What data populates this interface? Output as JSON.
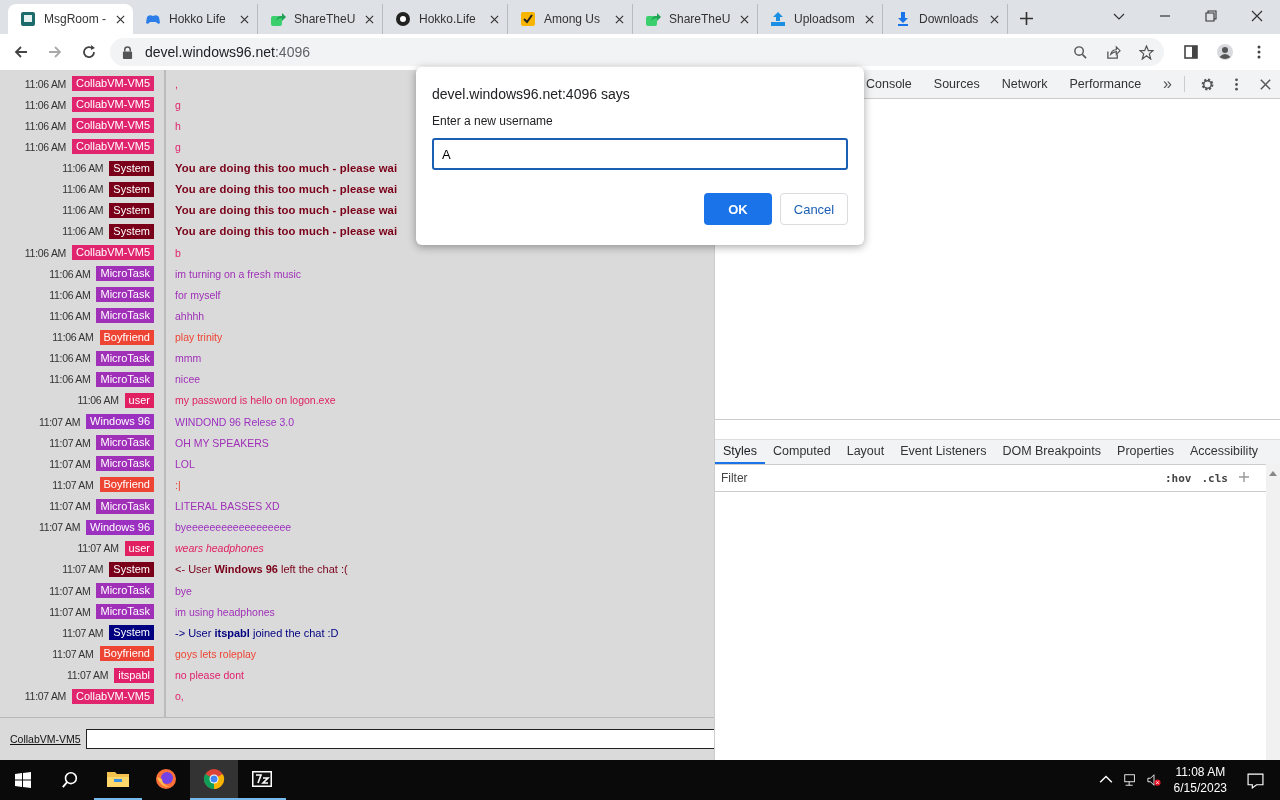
{
  "browser_tabs": [
    {
      "title": "MsgRoom -",
      "kind": "room",
      "selected": true
    },
    {
      "title": "Hokko Life",
      "kind": "gamepad",
      "selected": false
    },
    {
      "title": "ShareTheU",
      "kind": "share",
      "selected": false
    },
    {
      "title": "Hokko.Life",
      "kind": "wheel",
      "selected": false
    },
    {
      "title": "Among Us",
      "kind": "check",
      "selected": false
    },
    {
      "title": "ShareTheU",
      "kind": "share",
      "selected": false
    },
    {
      "title": "Uploadsom",
      "kind": "upload",
      "selected": false
    },
    {
      "title": "Downloads",
      "kind": "download",
      "selected": false
    }
  ],
  "address_bar": {
    "host": "devel.windows96.net",
    "port": ":4096"
  },
  "chat": {
    "messages": [
      {
        "time": "11:06 AM",
        "name": "CollabVM-VM5",
        "color": "#e0246e",
        "text": ",",
        "kind": "plain"
      },
      {
        "time": "11:06 AM",
        "name": "CollabVM-VM5",
        "color": "#e0246e",
        "text": "g",
        "kind": "plain"
      },
      {
        "time": "11:06 AM",
        "name": "CollabVM-VM5",
        "color": "#e0246e",
        "text": "h",
        "kind": "plain"
      },
      {
        "time": "11:06 AM",
        "name": "CollabVM-VM5",
        "color": "#e0246e",
        "text": "g",
        "kind": "plain"
      },
      {
        "time": "11:06 AM",
        "name": "System",
        "color": "#7a0019",
        "text": "You are doing this too much - please wai",
        "kind": "bold"
      },
      {
        "time": "11:06 AM",
        "name": "System",
        "color": "#7a0019",
        "text": "You are doing this too much - please wai",
        "kind": "bold"
      },
      {
        "time": "11:06 AM",
        "name": "System",
        "color": "#7a0019",
        "text": "You are doing this too much - please wai",
        "kind": "bold"
      },
      {
        "time": "11:06 AM",
        "name": "System",
        "color": "#7a0019",
        "text": "You are doing this too much - please wai",
        "kind": "bold"
      },
      {
        "time": "11:06 AM",
        "name": "CollabVM-VM5",
        "color": "#e0246e",
        "text": "b",
        "kind": "plain"
      },
      {
        "time": "11:06 AM",
        "name": "MicroTask",
        "color": "#a030b8",
        "text": "im turning on a fresh music",
        "kind": "plain"
      },
      {
        "time": "11:06 AM",
        "name": "MicroTask",
        "color": "#a030b8",
        "text": "for myself",
        "kind": "plain"
      },
      {
        "time": "11:06 AM",
        "name": "MicroTask",
        "color": "#a030b8",
        "text": "ahhhh",
        "kind": "plain"
      },
      {
        "time": "11:06 AM",
        "name": "Boyfriend",
        "color": "#ee4433",
        "text": "play trinity",
        "kind": "plain"
      },
      {
        "time": "11:06 AM",
        "name": "MicroTask",
        "color": "#a030b8",
        "text": "mmm",
        "kind": "plain"
      },
      {
        "time": "11:06 AM",
        "name": "MicroTask",
        "color": "#a030b8",
        "text": "nicee",
        "kind": "plain"
      },
      {
        "time": "11:06 AM",
        "name": "user",
        "color": "#e02060",
        "text": "my password is hello on logon.exe",
        "kind": "plain"
      },
      {
        "time": "11:07 AM",
        "name": "Windows 96",
        "color": "#9c30c0",
        "text": "WINDOND 96 Relese 3.0",
        "kind": "plain"
      },
      {
        "time": "11:07 AM",
        "name": "MicroTask",
        "color": "#a030b8",
        "text": "OH MY SPEAKERS",
        "kind": "plain"
      },
      {
        "time": "11:07 AM",
        "name": "MicroTask",
        "color": "#a030b8",
        "text": "LOL",
        "kind": "plain"
      },
      {
        "time": "11:07 AM",
        "name": "Boyfriend",
        "color": "#ee4433",
        "text": ":|",
        "kind": "plain"
      },
      {
        "time": "11:07 AM",
        "name": "MicroTask",
        "color": "#a030b8",
        "text": "LITERAL BASSES XD",
        "kind": "plain"
      },
      {
        "time": "11:07 AM",
        "name": "Windows 96",
        "color": "#9c30c0",
        "text": "byeeeeeeeeeeeeeeeeee",
        "kind": "plain"
      },
      {
        "time": "11:07 AM",
        "name": "user",
        "color": "#e02060",
        "text": "wears headphones",
        "kind": "italic"
      },
      {
        "time": "11:07 AM",
        "name": "System",
        "color": "#7a0019",
        "text": "<- User **Windows 96** left the chat :(",
        "kind": "notice"
      },
      {
        "time": "11:07 AM",
        "name": "MicroTask",
        "color": "#a030b8",
        "text": "bye",
        "kind": "plain"
      },
      {
        "time": "11:07 AM",
        "name": "MicroTask",
        "color": "#a030b8",
        "text": "im using headphones",
        "kind": "plain"
      },
      {
        "time": "11:07 AM",
        "name": "System",
        "color": "#000080",
        "text": "-> User **itspabl** joined the chat :D",
        "kind": "notice"
      },
      {
        "time": "11:07 AM",
        "name": "Boyfriend",
        "color": "#ee4433",
        "text": "goys lets roleplay",
        "kind": "plain"
      },
      {
        "time": "11:07 AM",
        "name": "itspabl",
        "color": "#e0206a",
        "text": "no please dont",
        "kind": "plain"
      },
      {
        "time": "11:07 AM",
        "name": "CollabVM-VM5",
        "color": "#e0246e",
        "text": "o,",
        "kind": "plain"
      }
    ],
    "nick_link": "CollabVM-VM5"
  },
  "dialog": {
    "title": "devel.windows96.net:4096 says",
    "label": "Enter a new username",
    "value": "A",
    "buttons": [
      {
        "label": "OK",
        "kind": "primary"
      },
      {
        "label": "Cancel",
        "kind": "secondary"
      }
    ]
  },
  "devtools": {
    "tabs": [
      "Console",
      "Sources",
      "Network",
      "Performance"
    ],
    "more": "»",
    "style_tabs": [
      {
        "label": "Styles",
        "selected": true
      },
      {
        "label": "Computed",
        "selected": false
      },
      {
        "label": "Layout",
        "selected": false
      },
      {
        "label": "Event Listeners",
        "selected": false
      },
      {
        "label": "DOM Breakpoints",
        "selected": false
      },
      {
        "label": "Properties",
        "selected": false
      },
      {
        "label": "Accessibility",
        "selected": false
      }
    ],
    "filter_placeholder": "Filter",
    "hov": ":hov",
    "cls": ".cls"
  },
  "taskbar": {
    "apps": [
      {
        "kind": "explorer",
        "open": true,
        "selected": false
      },
      {
        "kind": "firefox",
        "open": false,
        "selected": false
      },
      {
        "kind": "chrome",
        "open": true,
        "selected": true
      },
      {
        "kind": "archiver",
        "open": true,
        "selected": false
      }
    ],
    "time": "11:08 AM",
    "date": "6/15/2023"
  }
}
